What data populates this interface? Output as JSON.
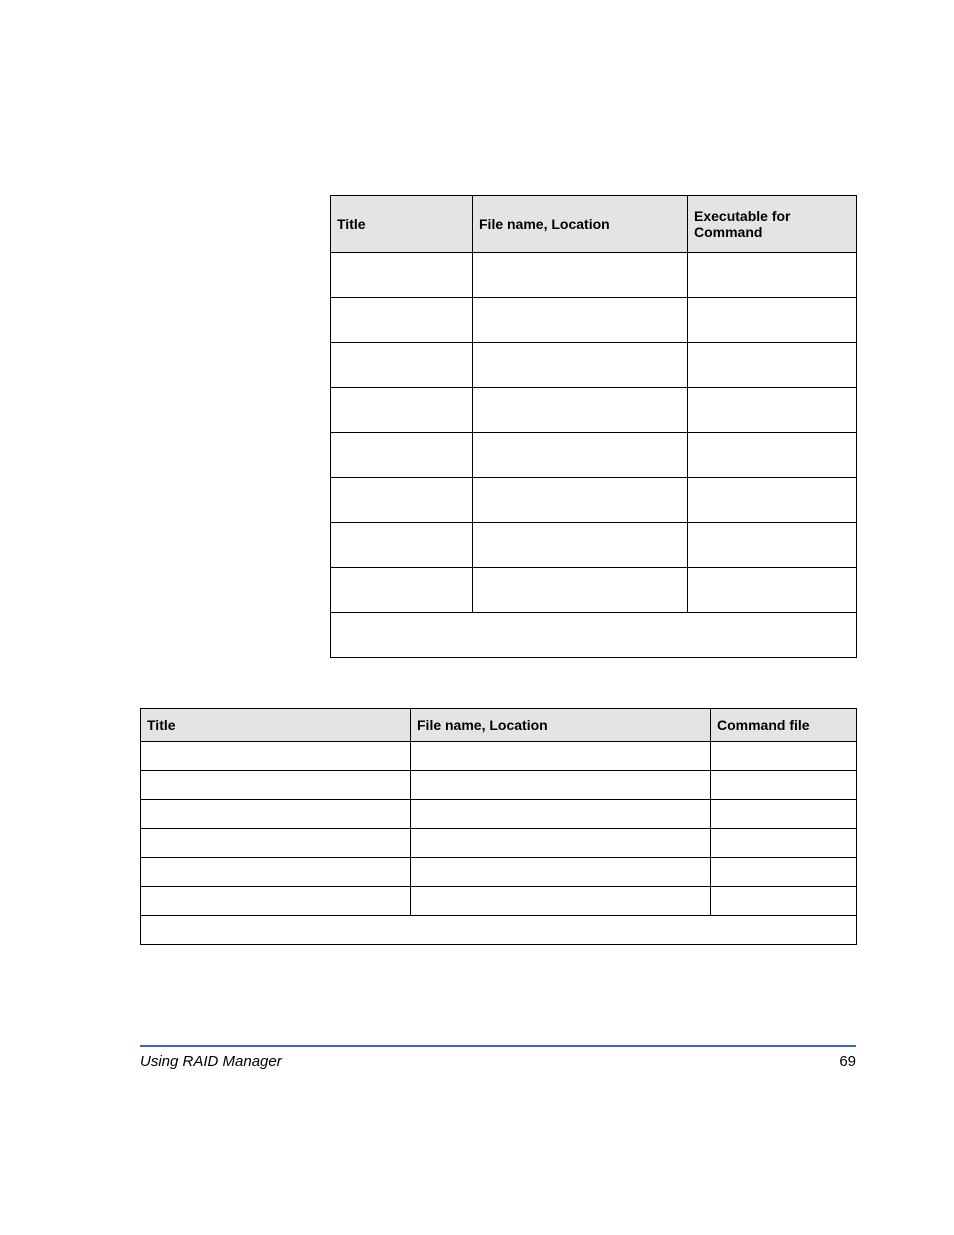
{
  "table1": {
    "headers": {
      "col1": "Title",
      "col2": "File name, Location",
      "col3": "Executable for Command"
    },
    "rows": [
      {
        "c1": "",
        "c2": "",
        "c3": ""
      },
      {
        "c1": "",
        "c2": "",
        "c3": ""
      },
      {
        "c1": "",
        "c2": "",
        "c3": ""
      },
      {
        "c1": "",
        "c2": "",
        "c3": ""
      },
      {
        "c1": "",
        "c2": "",
        "c3": ""
      },
      {
        "c1": "",
        "c2": "",
        "c3": ""
      },
      {
        "c1": "",
        "c2": "",
        "c3": ""
      },
      {
        "c1": "",
        "c2": "",
        "c3": ""
      }
    ],
    "last": {
      "c1": ""
    }
  },
  "table2": {
    "headers": {
      "col1": "Title",
      "col2": "File name, Location",
      "col3": "Command file"
    },
    "rows": [
      {
        "c1": "",
        "c2": "",
        "c3": ""
      },
      {
        "c1": "",
        "c2": "",
        "c3": ""
      },
      {
        "c1": "",
        "c2": "",
        "c3": ""
      },
      {
        "c1": "",
        "c2": "",
        "c3": ""
      },
      {
        "c1": "",
        "c2": "",
        "c3": ""
      },
      {
        "c1": "",
        "c2": "",
        "c3": ""
      }
    ],
    "last": {
      "c1": ""
    }
  },
  "footer": {
    "title": "Using RAID Manager",
    "page": "69"
  }
}
